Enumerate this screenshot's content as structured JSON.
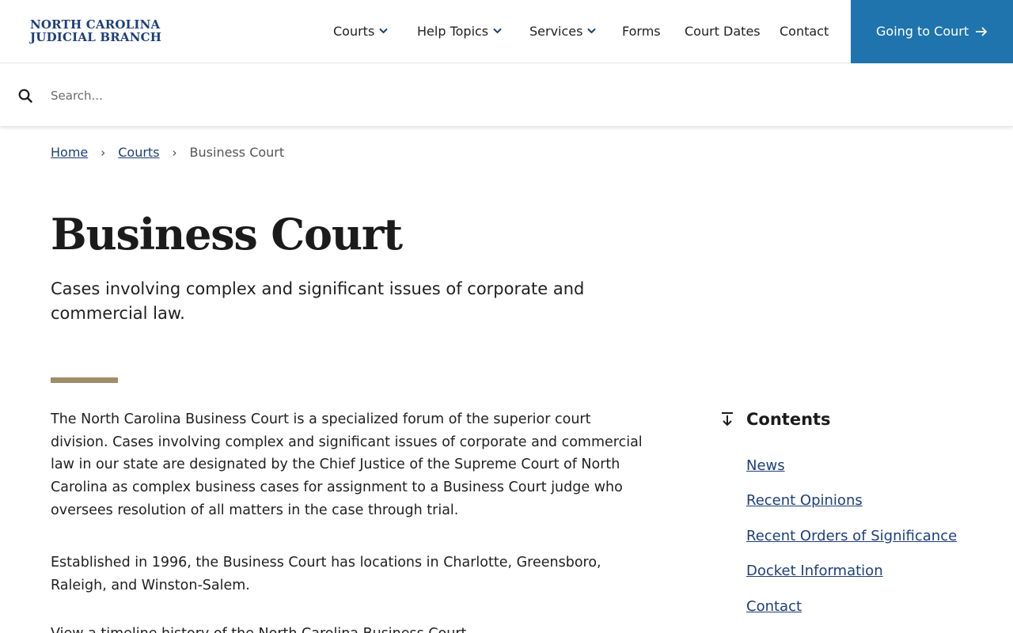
{
  "header": {
    "logo_line1": "NORTH CAROLINA",
    "logo_line2": "JUDICIAL BRANCH",
    "nav": [
      {
        "label": "Courts"
      },
      {
        "label": "Help Topics"
      },
      {
        "label": "Services"
      },
      {
        "label": "Forms"
      },
      {
        "label": "Court Dates"
      },
      {
        "label": "Contact"
      }
    ],
    "cta_label": "Going to Court"
  },
  "search": {
    "placeholder": "Search..."
  },
  "breadcrumb": {
    "items": [
      "Home",
      "Courts"
    ],
    "separator": "›",
    "current": "Business Court"
  },
  "page": {
    "title": "Business Court",
    "subtitle": "Cases involving complex and significant issues of corporate and commercial law.",
    "paragraphs": [
      "The North Carolina Business Court is a specialized forum of the superior court division. Cases involving complex and significant issues of corporate and commercial law in our state are designated by the Chief Justice of the Supreme Court of North Carolina as complex business cases for assignment to a Business Court judge who oversees resolution of all matters in the case through trial.",
      "Established in 1996, the Business Court has locations in Charlotte, Greensboro, Raleigh, and Winston-Salem.",
      "View a timeline history of the North Carolina Business Court."
    ]
  },
  "contents": {
    "title": "Contents",
    "items": [
      "News",
      "Recent Opinions",
      "Recent Orders of Significance",
      "Docket Information",
      "Contact"
    ]
  },
  "colors": {
    "brand_blue": "#1f74ad",
    "link_navy": "#1d3f7a",
    "accent_gold": "#a08c68"
  },
  "icons": {
    "search": "search-icon",
    "chevron": "chevron-down-icon",
    "cta_arrow": "arrow-right-icon",
    "contents": "arrow-down-to-line-icon"
  }
}
